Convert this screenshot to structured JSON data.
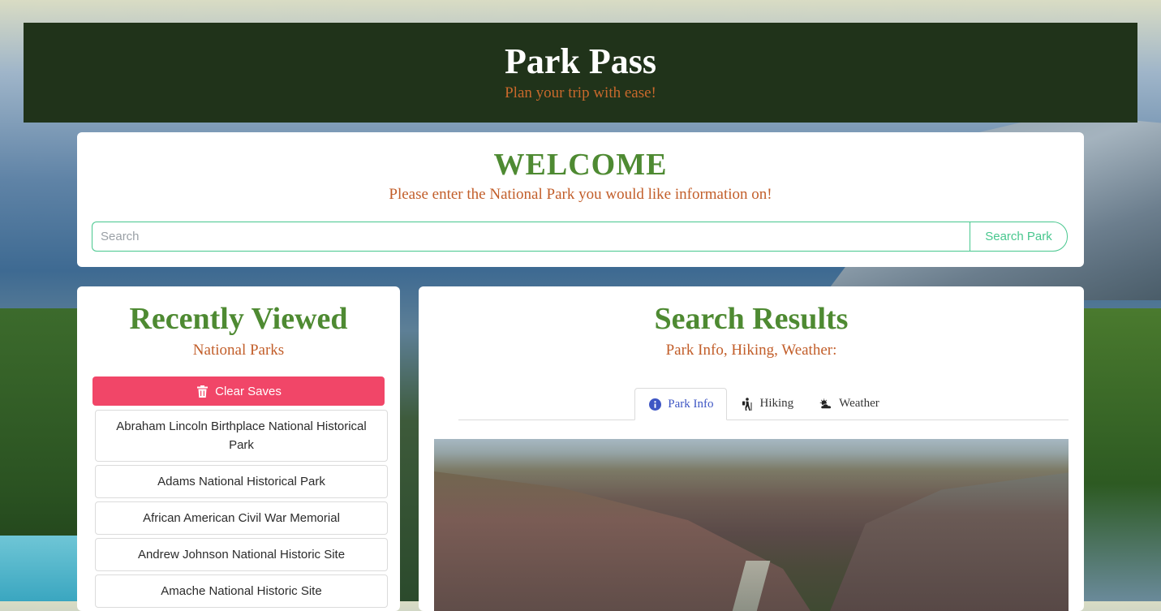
{
  "header": {
    "title": "Park Pass",
    "tagline": "Plan your trip with ease!"
  },
  "welcome": {
    "title": "WELCOME",
    "subtitle": "Please enter the National Park you would like information on!",
    "search": {
      "placeholder": "Search",
      "value": "",
      "button_label": "Search Park"
    }
  },
  "recent": {
    "title": "Recently Viewed",
    "subtitle": "National Parks",
    "clear_button_label": "Clear Saves",
    "clear_button_icon": "trash-icon",
    "items": [
      "Abraham Lincoln Birthplace National Historical Park",
      "Adams National Historical Park",
      "African American Civil War Memorial",
      "Andrew Johnson National Historic Site",
      "Amache National Historic Site"
    ]
  },
  "results": {
    "title": "Search Results",
    "subtitle": "Park Info, Hiking, Weather:",
    "tabs": [
      {
        "label": "Park Info",
        "icon": "info-circle-icon",
        "active": true
      },
      {
        "label": "Hiking",
        "icon": "hiking-icon",
        "active": false
      },
      {
        "label": "Weather",
        "icon": "cloud-sun-icon",
        "active": false
      }
    ]
  },
  "colors": {
    "header_bg": "#20331a",
    "accent_green": "#4e8a32",
    "accent_orange": "#c25e2a",
    "primary_teal": "#48c78e",
    "danger": "#f14668",
    "link_blue": "#3e56c4"
  }
}
